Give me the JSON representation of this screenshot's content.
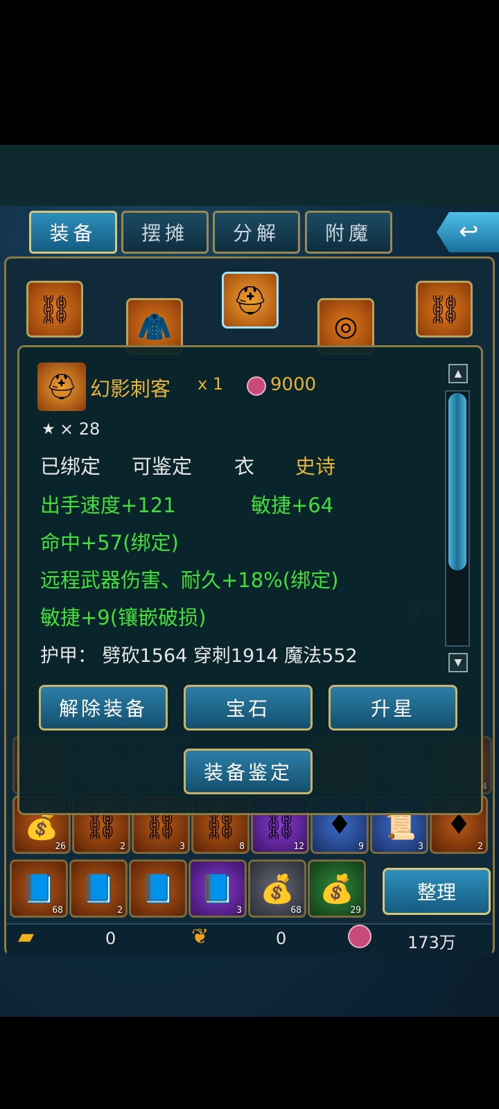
{
  "tabs": [
    {
      "label": "装备"
    },
    {
      "label": "摆摊"
    },
    {
      "label": "分解"
    },
    {
      "label": "附魔"
    }
  ],
  "back_icon": "back-arrow-icon",
  "equip_slots": [
    {
      "icon": "chain-necklace-icon"
    },
    {
      "icon": "red-armor-icon"
    },
    {
      "icon": "winged-helmet-icon"
    },
    {
      "icon": "ring-icon"
    },
    {
      "icon": "chain-necklace-icon"
    }
  ],
  "item_tooltip": {
    "name": "幻影刺客",
    "quantity": "x 1",
    "price_icon": "coin-icon",
    "price": "9000",
    "stars": "× 28",
    "bound": "已绑定",
    "appraisable": "可鉴定",
    "slot_type": "衣",
    "quality": "史诗",
    "stats": [
      "出手速度+121",
      "敏捷+64",
      "命中+57(绑定)",
      "远程武器伤害、耐久+18%(绑定)",
      "敏捷+9(镶嵌破损)"
    ],
    "armor": "护甲： 劈砍1564  穿刺1914  魔法552",
    "buttons": {
      "unequip": "解除装备",
      "gem": "宝石",
      "star_up": "升星",
      "appraise": "装备鉴定"
    }
  },
  "query_hint": "查询",
  "inventory_rows": [
    [
      {
        "icon": "coin-bag-icon",
        "count": "26",
        "color": "orange"
      },
      {
        "icon": "chain-necklace-icon",
        "count": "2",
        "color": "orange"
      },
      {
        "icon": "chain-necklace-icon",
        "count": "3",
        "color": "orange"
      },
      {
        "icon": "chain-necklace-icon",
        "count": "8",
        "color": "orange"
      },
      {
        "icon": "chain-necklace-icon",
        "count": "12",
        "color": "purple"
      },
      {
        "icon": "red-gem-icon",
        "count": "9",
        "color": "blue"
      },
      {
        "icon": "scroll-icon",
        "count": "3",
        "color": "blue"
      },
      {
        "icon": "red-gem-icon",
        "count": "2",
        "color": "orange"
      }
    ],
    [
      {
        "icon": "blue-book-icon",
        "count": "68",
        "color": "orange"
      },
      {
        "icon": "blue-book-icon",
        "count": "2",
        "color": "orange"
      },
      {
        "icon": "blue-book-icon",
        "count": "",
        "color": "orange"
      },
      {
        "icon": "blue-book-icon",
        "count": "3",
        "color": "purple"
      },
      {
        "icon": "coin-bag-icon",
        "count": "68",
        "color": "gray"
      },
      {
        "icon": "coin-bag-icon",
        "count": "29",
        "color": "green"
      }
    ]
  ],
  "hidden_row_counts": [
    "2",
    "6",
    "4",
    "4"
  ],
  "sort_button": "整理",
  "currency": {
    "gold_icon": "gold-bar-icon",
    "gold": "0",
    "leaf_icon": "leaf-icon",
    "leaf": "0",
    "coin_icon": "coin-icon",
    "coins": "173万"
  },
  "colors": {
    "accent": "#2f8fbd",
    "gold_border": "#c9b46a",
    "name": "#e6b43a",
    "stat": "#3fe03a"
  }
}
